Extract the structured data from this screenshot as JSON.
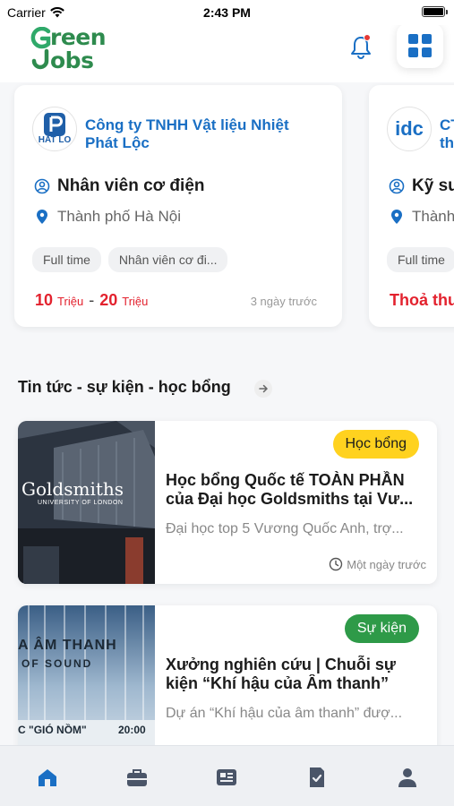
{
  "status_bar": {
    "carrier": "Carrier",
    "time": "2:43 PM"
  },
  "header": {
    "logo_line1": "reen",
    "logo_line2": "obs",
    "icons": [
      "bell-icon",
      "grid-menu-icon"
    ],
    "colors": {
      "brand_green": "#2e8b4e",
      "accent_blue": "#1a6fc4",
      "notification_dot": "#e53935"
    }
  },
  "jobs": [
    {
      "company": "Công ty TNHH Vật liệu Nhiệt\nPhát Lộc",
      "logo_text": "HAT LO",
      "title": "Nhân viên cơ điện",
      "location": "Thành phố Hà Nội",
      "tags": [
        "Full time",
        "Nhân viên cơ đi..."
      ],
      "salary_min": "10",
      "salary_max": "20",
      "salary_unit": "Triệu",
      "posted": "3 ngày trước"
    },
    {
      "company": "CT\nth",
      "logo_text": "idc",
      "title": "Kỹ sư",
      "location": "Thành",
      "tags": [
        "Full time"
      ],
      "salary_text": "Thoả thu"
    }
  ],
  "news_section": {
    "title": "Tin tức - sự kiện - học bổng"
  },
  "news": [
    {
      "badge": "Học bổng",
      "badge_color": "#ffd21f",
      "thumb_text": "Goldsmiths",
      "thumb_subtext": "UNIVERSITY OF LONDON",
      "title_line1": "Học bổng Quốc tế TOÀN PHẦN",
      "title_line2": "của Đại học Goldsmiths tại Vư...",
      "desc": "Đại học top 5 Vương Quốc Anh, trợ...",
      "time": "Một ngày trước"
    },
    {
      "badge": "Sự kiện",
      "badge_color": "#2e9a48",
      "thumb_text": "A ÂM THANH",
      "thumb_subtext": "OF SOUND",
      "thumb_footer": "C \"GIÓ NỒM\"",
      "thumb_footer_time": "20:00",
      "title_line1": "Xưởng nghiên cứu | Chuỗi sự",
      "title_line2": "kiện “Khí hậu của Âm thanh”",
      "desc": "Dự án “Khí hậu của  âm thanh” đượ..."
    }
  ],
  "bottom_nav": {
    "items": [
      "home-icon",
      "briefcase-icon",
      "news-icon",
      "document-check-icon",
      "profile-icon"
    ],
    "active": "home-icon",
    "active_color": "#1a6fc4",
    "inactive_color": "#4a5568"
  }
}
